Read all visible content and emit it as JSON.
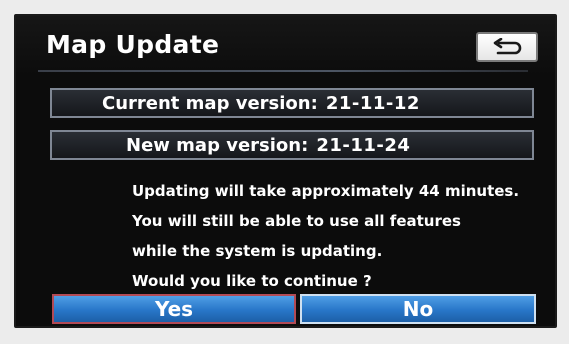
{
  "header": {
    "title": "Map Update"
  },
  "versions": {
    "current_label": "Current map version:",
    "current_value": "21-11-12",
    "new_label": "New map version:",
    "new_value": "21-11-24"
  },
  "message": {
    "lines": [
      "Updating will take approximately 44 minutes.",
      "You will still be able to use all features",
      "while the system is updating.",
      "Would you like to continue ?"
    ]
  },
  "buttons": {
    "yes_label": "Yes",
    "no_label": "No"
  },
  "icons": {
    "back": "back-arrow-icon"
  },
  "colors": {
    "screen_background": "#0c0c0c",
    "button_blue": "#2876c8",
    "row_border": "#7f8794",
    "text": "#ffffff"
  }
}
